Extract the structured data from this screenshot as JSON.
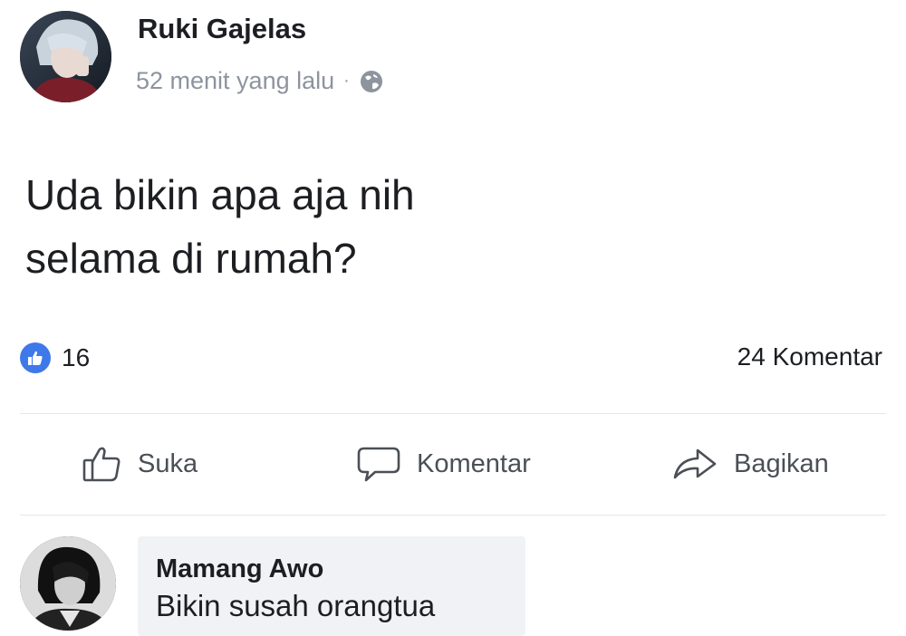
{
  "post": {
    "author": {
      "name": "Ruki Gajelas",
      "avatar_icon": "user-avatar-photo"
    },
    "meta": {
      "time": "52 menit yang lalu",
      "separator": "·",
      "privacy_icon": "globe-icon"
    },
    "text_lines": [
      "Uda bikin apa aja nih",
      "selama di rumah?"
    ],
    "reactions": {
      "like_icon": "like-badge-icon",
      "like_count": "16",
      "comment_count": "24 Komentar"
    },
    "actions": {
      "like_label": "Suka",
      "comment_label": "Komentar",
      "share_label": "Bagikan"
    }
  },
  "comment": {
    "author": "Mamang Awo",
    "text": "Bikin susah orangtua",
    "avatar_icon": "user-avatar-photo"
  },
  "colors": {
    "like_blue": "#3f78e8",
    "meta_gray": "#8d949e",
    "action_gray": "#4b4f56",
    "bubble_bg": "#f0f2f5"
  }
}
